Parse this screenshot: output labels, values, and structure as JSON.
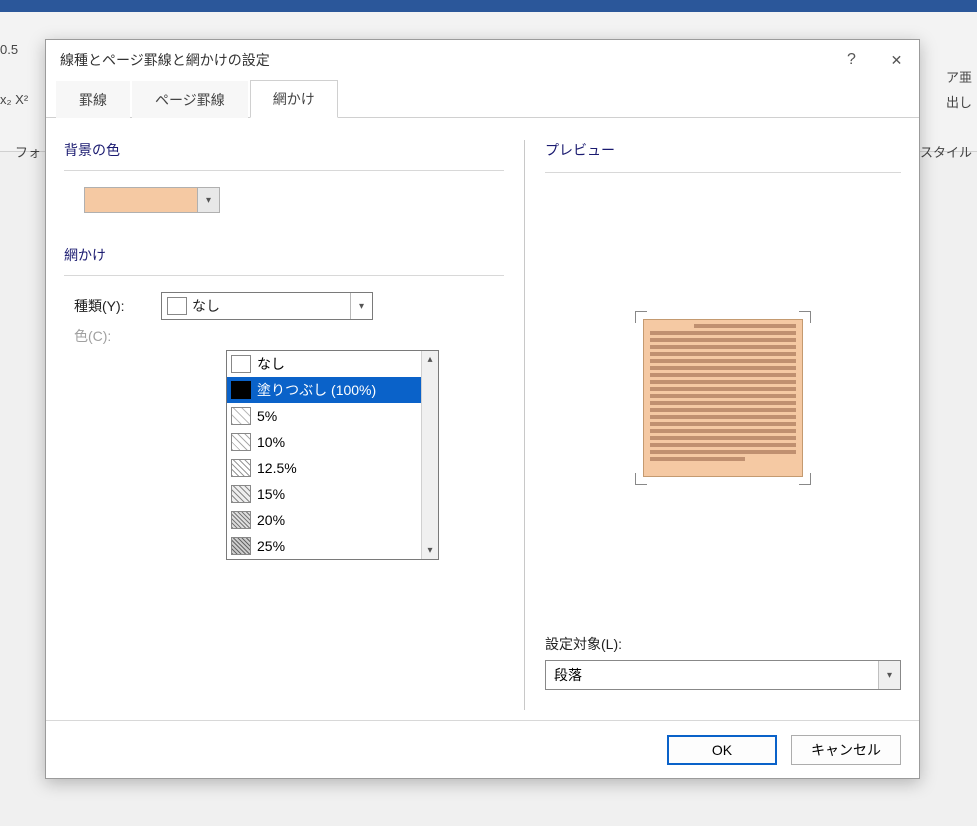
{
  "ribbon": {
    "zoom": "0.5",
    "x2": "x₂  X²",
    "font_group": "フォ",
    "right1": "ア亜",
    "right2": "出し",
    "styles_group": "スタイル"
  },
  "dialog": {
    "title": "線種とページ罫線と網かけの設定",
    "help": "?",
    "close": "✕",
    "tabs": [
      "罫線",
      "ページ罫線",
      "網かけ"
    ],
    "active_tab": 2,
    "left": {
      "bg_section": "背景の色",
      "bg_color": "#f5c9a3",
      "shade_section": "網かけ",
      "type_label": "種類(Y):",
      "type_value": "なし",
      "color_label": "色(C):",
      "dropdown_items": [
        "なし",
        "塗りつぶし (100%)",
        "5%",
        "10%",
        "12.5%",
        "15%",
        "20%",
        "25%"
      ],
      "selected_index": 1
    },
    "right": {
      "preview_label": "プレビュー",
      "apply_label": "設定対象(L):",
      "apply_value": "段落"
    },
    "footer": {
      "ok": "OK",
      "cancel": "キャンセル"
    }
  }
}
